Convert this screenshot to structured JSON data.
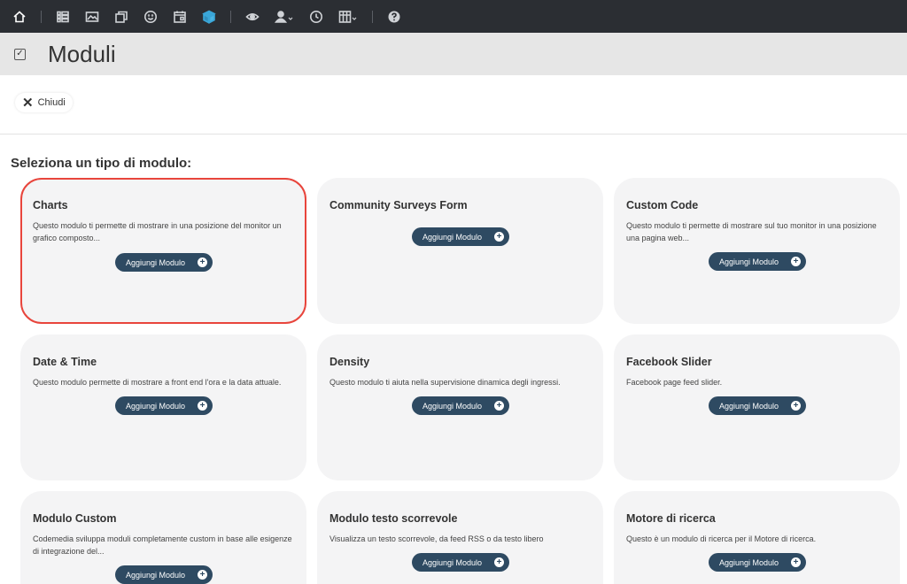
{
  "toolbar": {
    "icons": [
      "home-icon",
      "grid-icon",
      "image-icon",
      "layers-icon",
      "smile-icon",
      "calendar-icon",
      "cube-icon",
      "eye-icon",
      "user-icon",
      "clock-icon",
      "columns-icon",
      "help-icon"
    ],
    "colors": {
      "bar": "#2b2e33",
      "accent": "#3aa6d8"
    }
  },
  "header": {
    "title": "Moduli"
  },
  "actions": {
    "close_label": "Chiudi"
  },
  "section": {
    "title": "Seleziona un tipo di modulo:"
  },
  "add_label": "Aggiungi Modulo",
  "cards": [
    {
      "title": "Charts",
      "desc": "Questo modulo ti permette di mostrare in una posizione del monitor un grafico composto..."
    },
    {
      "title": "Community Surveys Form",
      "desc": ""
    },
    {
      "title": "Custom Code",
      "desc": "Questo modulo ti permette di mostrare sul tuo monitor in una posizione una pagina web..."
    },
    {
      "title": "Date & Time",
      "desc": "Questo modulo permette di mostrare a front end l'ora e la data attuale."
    },
    {
      "title": "Density",
      "desc": "Questo modulo ti aiuta nella supervisione dinamica degli ingressi."
    },
    {
      "title": "Facebook Slider",
      "desc": "Facebook page feed slider."
    },
    {
      "title": "Modulo Custom",
      "desc": "Codemedia sviluppa moduli completamente custom in base alle esigenze di integrazione del..."
    },
    {
      "title": "Modulo testo scorrevole",
      "desc": "Visualizza un testo scorrevole, da feed RSS o da testo libero"
    },
    {
      "title": "Motore di ricerca",
      "desc": "Questo è un modulo di ricerca per il Motore di ricerca."
    }
  ],
  "selected_color": "#e8453c"
}
